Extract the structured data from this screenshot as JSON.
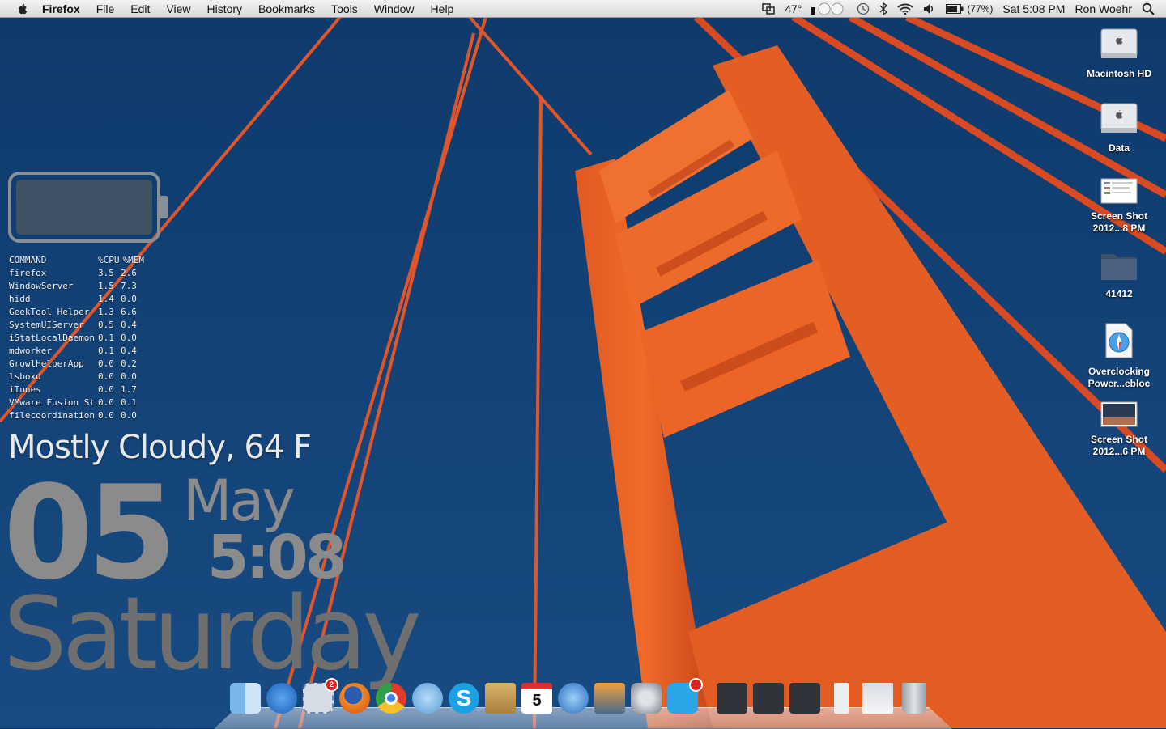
{
  "menubar": {
    "app": "Firefox",
    "menus": [
      "File",
      "Edit",
      "View",
      "History",
      "Bookmarks",
      "Tools",
      "Window",
      "Help"
    ],
    "temperature": "47°",
    "battery": "(77%)",
    "clock": "Sat 5:08 PM",
    "user": "Ron Woehr"
  },
  "processes": {
    "header": {
      "cmd": "COMMAND",
      "cpu": "%CPU",
      "mem": "%MEM"
    },
    "rows": [
      {
        "cmd": "firefox",
        "cpu": "3.5",
        "mem": "2.6"
      },
      {
        "cmd": "WindowServer",
        "cpu": "1.5",
        "mem": "7.3"
      },
      {
        "cmd": "hidd",
        "cpu": "1.4",
        "mem": "0.0"
      },
      {
        "cmd": "GeekTool Helper",
        "cpu": "1.3",
        "mem": "6.6"
      },
      {
        "cmd": "SystemUIServer",
        "cpu": "0.5",
        "mem": "0.4"
      },
      {
        "cmd": "iStatLocalDaemon",
        "cpu": "0.1",
        "mem": "0.0"
      },
      {
        "cmd": "mdworker",
        "cpu": "0.1",
        "mem": "0.4"
      },
      {
        "cmd": "GrowlHelperApp",
        "cpu": "0.0",
        "mem": "0.2"
      },
      {
        "cmd": "lsboxd",
        "cpu": "0.0",
        "mem": "0.0"
      },
      {
        "cmd": "iTunes",
        "cpu": "0.0",
        "mem": "1.7"
      },
      {
        "cmd": "VMware Fusion St",
        "cpu": "0.0",
        "mem": "0.1"
      },
      {
        "cmd": "filecoordination",
        "cpu": "0.0",
        "mem": "0.0"
      }
    ]
  },
  "weather": "Mostly Cloudy, 64 F",
  "date": {
    "day": "05",
    "month": "May",
    "time": "5:08",
    "weekday": "Saturday"
  },
  "desktop_icons": [
    {
      "label": "Macintosh HD",
      "icon": "hard-drive-icon"
    },
    {
      "label": "Data",
      "icon": "hard-drive-icon"
    },
    {
      "label": "Screen Shot 2012...8 PM",
      "icon": "screenshot-file-icon"
    },
    {
      "label": "41412",
      "icon": "folder-icon"
    },
    {
      "label": "Overclocking Power...ebloc",
      "icon": "safari-document-icon"
    },
    {
      "label": "Screen Shot 2012...6 PM",
      "icon": "screenshot-file-icon"
    }
  ],
  "dock": {
    "items": [
      {
        "name": "finder",
        "color": "#6aa8e0"
      },
      {
        "name": "app-store",
        "color": "#2f7fd6"
      },
      {
        "name": "mail",
        "color": "#c8d0d8",
        "badge": "2"
      },
      {
        "name": "firefox",
        "color": "#e86a1c"
      },
      {
        "name": "chrome",
        "color": "#e8e8e8"
      },
      {
        "name": "facetime",
        "color": "#7ab8e8"
      },
      {
        "name": "skype",
        "color": "#1ba0e2"
      },
      {
        "name": "address-book",
        "color": "#c9a15a"
      },
      {
        "name": "ical",
        "color": "#ffffff",
        "text": "5"
      },
      {
        "name": "itunes",
        "color": "#3a80d0"
      },
      {
        "name": "iphoto",
        "color": "#8a9aa8"
      },
      {
        "name": "system-preferences",
        "color": "#a0a4aa"
      },
      {
        "name": "twitter",
        "color": "#2aa6e6"
      },
      {
        "name": "applications-stack",
        "color": "#2a2e34"
      },
      {
        "name": "documents-stack",
        "color": "#2a2e34"
      },
      {
        "name": "downloads-stack",
        "color": "#2a2e34"
      },
      {
        "name": "preview-doc",
        "color": "#e8eaee"
      },
      {
        "name": "firefox-window",
        "color": "#e8eaee"
      },
      {
        "name": "trash",
        "color": "#b8bcc2"
      }
    ]
  }
}
